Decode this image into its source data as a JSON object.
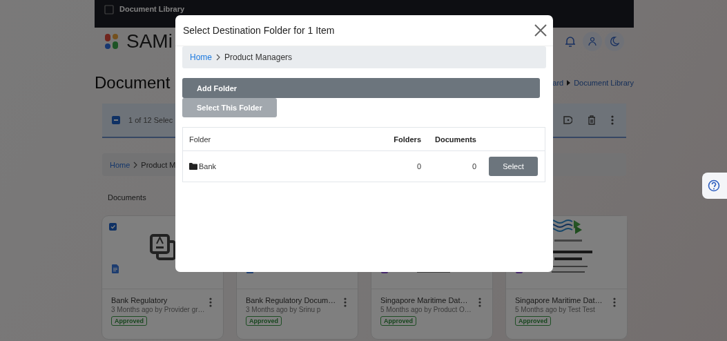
{
  "top_bar": {
    "title": "Document Library"
  },
  "header": {
    "logo_text": "SAMi"
  },
  "page": {
    "title": "Document",
    "breadcrumb": [
      "ard",
      "Document Library"
    ]
  },
  "selection_bar": {
    "indeterminate": true,
    "text": "1 of 12 Selec"
  },
  "breadcrumb": [
    "Home",
    "Product M"
  ],
  "section_title": "Documents",
  "cards": [
    {
      "title": "Bank Regulatory",
      "subtitle": "3 Months ago by Provider gr…",
      "status": "Approved",
      "checked": true,
      "kind": "icon"
    },
    {
      "title": "Bank Regulatory Docum…",
      "subtitle": "3 Months ago by Srinu p",
      "status": "Approved",
      "kind": "file"
    },
    {
      "title": "Singapore Maritime Dat…",
      "subtitle": "5 Months ago by Product O…",
      "status": "Approved",
      "kind": "picture"
    },
    {
      "title": "Singapore Maritime Dat…",
      "subtitle": "5 Months ago by Test Test",
      "status": "Approved",
      "kind": "picture"
    }
  ],
  "dialog": {
    "title": "Select Destination Folder for 1 Item",
    "breadcrumb": [
      "Home",
      "Product Managers"
    ],
    "buttons": [
      {
        "label": "Add Folder",
        "disabled": false
      },
      {
        "label": "Select This Folder",
        "disabled": true
      }
    ],
    "table": {
      "columns": [
        "Folder",
        "Folders",
        "Documents"
      ],
      "rows": [
        {
          "name": "Bank",
          "folders": "0",
          "documents": "0",
          "action": "Select"
        }
      ]
    }
  }
}
